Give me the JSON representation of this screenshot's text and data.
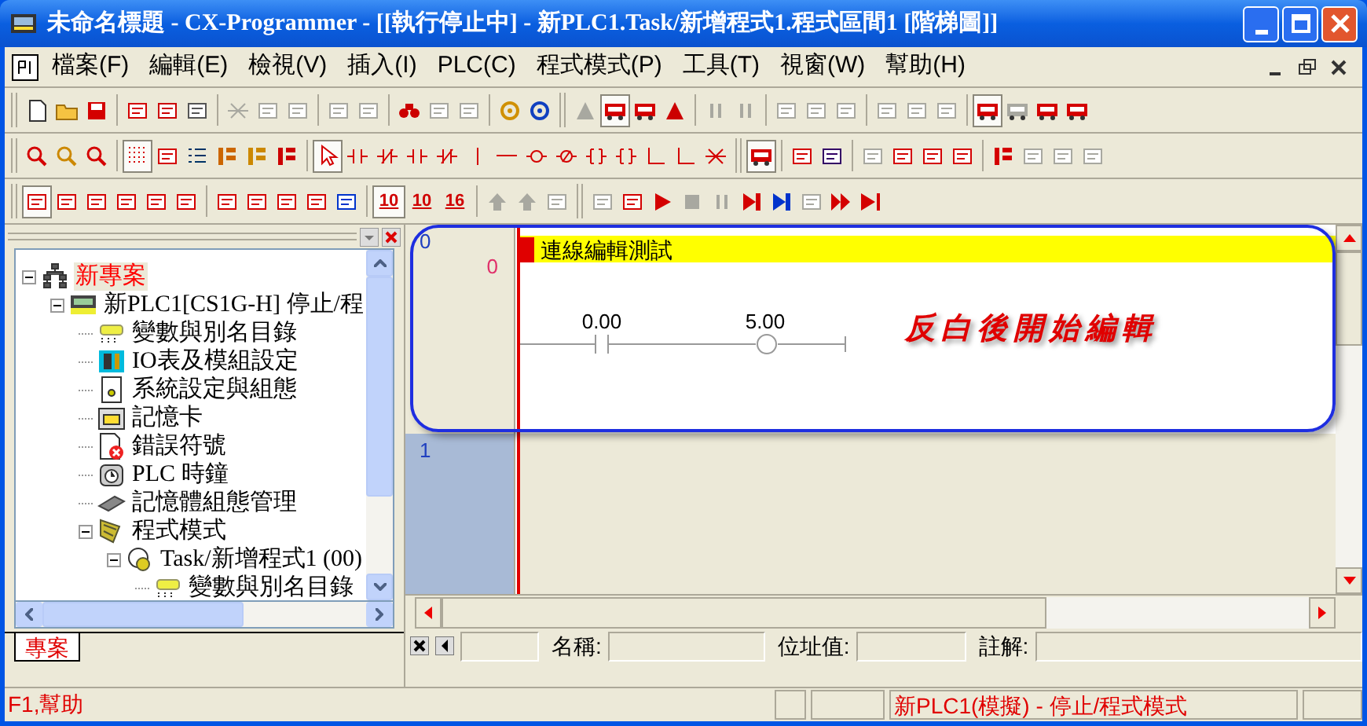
{
  "window": {
    "title": "未命名標題 - CX-Programmer - [[執行停止中] - 新PLC1.Task/新增程式1.程式區間1 [階梯圖]]"
  },
  "menu": [
    {
      "label": "檔案(F)"
    },
    {
      "label": "編輯(E)"
    },
    {
      "label": "檢視(V)"
    },
    {
      "label": "插入(I)"
    },
    {
      "label": "PLC(C)"
    },
    {
      "label": "程式模式(P)"
    },
    {
      "label": "工具(T)"
    },
    {
      "label": "視窗(W)"
    },
    {
      "label": "幫助(H)"
    }
  ],
  "number_buttons": [
    "10",
    "10",
    "16"
  ],
  "tree": [
    {
      "label": "新專案",
      "kind": "project",
      "selected": true,
      "expanded": true,
      "children": [
        {
          "label": "新PLC1[CS1G-H] 停止/程",
          "kind": "plc",
          "selected": false,
          "expanded": true,
          "children": [
            {
              "label": "變數與別名目錄",
              "kind": "symbols",
              "selected": false
            },
            {
              "label": "IO表及模組設定",
              "kind": "io",
              "selected": false
            },
            {
              "label": "系統設定與組態",
              "kind": "settings",
              "selected": false
            },
            {
              "label": "記憶卡",
              "kind": "card",
              "selected": false
            },
            {
              "label": "錯誤符號",
              "kind": "error",
              "selected": false
            },
            {
              "label": "PLC 時鐘",
              "kind": "clock",
              "selected": false
            },
            {
              "label": "記憶體組態管理",
              "kind": "memory",
              "selected": false
            },
            {
              "label": "程式模式",
              "kind": "programs",
              "selected": false,
              "expanded": true,
              "children": [
                {
                  "label": "Task/新增程式1 (00)",
                  "kind": "task",
                  "selected": false,
                  "expanded": true,
                  "children": [
                    {
                      "label": "變數與別名目錄",
                      "kind": "symbols",
                      "selected": false
                    }
                  ]
                }
              ]
            }
          ]
        }
      ]
    }
  ],
  "panel_tab": {
    "label": "專案",
    "selected": true
  },
  "ladder": {
    "rungs": [
      {
        "number": "0",
        "step": "0",
        "selected": false,
        "comment": "連線編輯測試",
        "elements": [
          {
            "kind": "contact",
            "operand": "0.00"
          },
          {
            "kind": "coil",
            "operand": "5.00"
          }
        ]
      },
      {
        "number": "1",
        "selected": true
      }
    ]
  },
  "annotation": "反白後開始編輯",
  "info_bar": {
    "fields": [
      {
        "label": "名稱:"
      },
      {
        "label": "位址值:"
      },
      {
        "label": "註解:"
      }
    ]
  },
  "status_bar": {
    "help": "F1,幫助",
    "plc_status": "新PLC1(模擬) - 停止/程式模式"
  }
}
